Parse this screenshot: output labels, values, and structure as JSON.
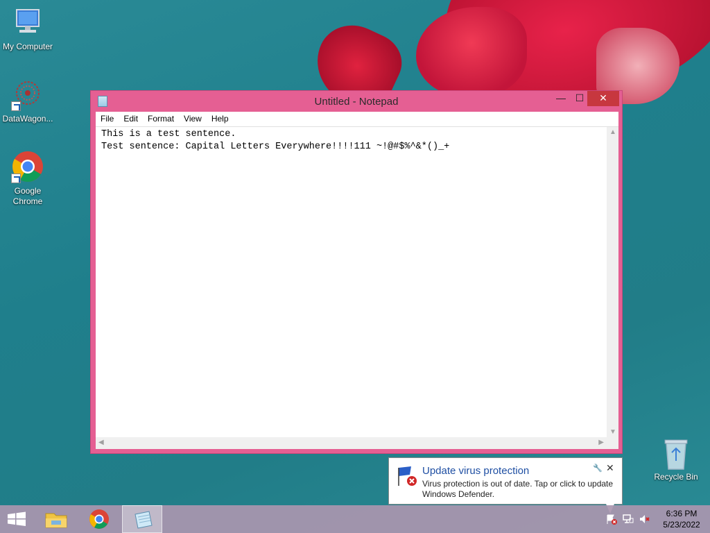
{
  "desktop": {
    "icons": [
      {
        "label": "My Computer"
      },
      {
        "label": "DataWagon..."
      },
      {
        "label": "Google Chrome"
      }
    ],
    "recycle_bin_label": "Recycle Bin"
  },
  "window": {
    "title": "Untitled - Notepad",
    "controls": {
      "minimize": "—",
      "maximize": "☐",
      "close": "✕"
    },
    "menu": [
      "File",
      "Edit",
      "Format",
      "View",
      "Help"
    ],
    "content": "This is a test sentence.\nTest sentence: Capital Letters Everywhere!!!!111 ~!@#$%^&*()_+"
  },
  "notification": {
    "title": "Update virus protection",
    "body": "Virus protection is out of date. Tap or click to update Windows Defender."
  },
  "taskbar": {
    "clock_time": "6:36 PM",
    "clock_date": "5/23/2022"
  },
  "colors": {
    "window_frame": "#e55f93",
    "desktop_bg": "#1f7f8c",
    "close_button": "#c7373f",
    "notification_title": "#1f4fa3"
  }
}
